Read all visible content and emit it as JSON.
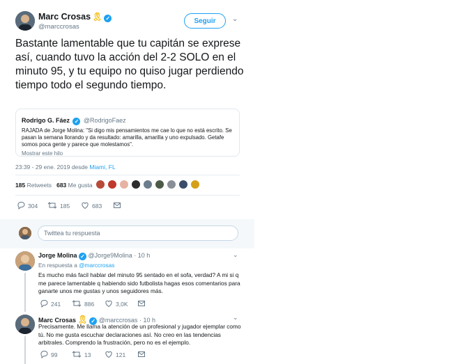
{
  "tweet": {
    "author_name": "Marc Crosas",
    "author_handle": "@marccrosas",
    "follow_label": "Seguir",
    "text": "Bastante lamentable que tu capitán se exprese así, cuando tuvo la acción del 2-2 SOLO en el minuto 95, y tu equipo no quiso jugar perdiendo tiempo todo el segundo tiempo.",
    "quote": {
      "author_name": "Rodrigo G. Fáez",
      "author_handle": "@RodrigoFaez",
      "text": "RAJADA de Jorge Molina: \"Si digo mis pensamientos me cae lo que no está escrito. Se pasan la semana llorando y da resultado: amarilla, amarilla y uno expulsado. Getafe somos poca gente y parece que molestamos\".",
      "thread_link": "Mostrar este hilo"
    },
    "timestamp": "23:39 - 29 ene. 2019 desde",
    "location": "Miami, FL",
    "retweets_count": "185",
    "retweets_label": "Retweets",
    "likes_count": "683",
    "likes_label": "Me gusta",
    "actions": {
      "replies": "304",
      "retweets": "185",
      "likes": "683"
    }
  },
  "compose": {
    "placeholder": "Twittea tu respuesta"
  },
  "replies": [
    {
      "author_name": "Jorge Molina",
      "author_handle": "@Jorge9Molina",
      "time": "· 10 h",
      "in_reply_prefix": "En respuesta a",
      "in_reply_handle": "@marccrosas",
      "text": "Es mucho más facil hablar del minuto 95 sentado en el sofa, verdad? A mi si q me parece lamentable q habiendo sido futbolista hagas esos comentarios para ganarte unos me gustas y unos seguidores más.",
      "actions": {
        "replies": "241",
        "retweets": "886",
        "likes": "3,0K"
      }
    },
    {
      "author_name": "Marc Crosas",
      "author_handle": "@marccrosas",
      "time": "· 10 h",
      "text": "Precisamente. Me llama la atención de un profesional y jugador ejemplar como tú. No me gusta escuchar declaraciones así. No creo en las tendencias arbitrales. Comprendo la frustración, pero no es el ejemplo.",
      "actions": {
        "replies": "99",
        "retweets": "13",
        "likes": "121"
      }
    }
  ],
  "icons": {
    "reply": "reply-icon",
    "retweet": "retweet-icon",
    "like": "heart-icon",
    "message": "direct-message-icon",
    "verified": "verified-badge-icon",
    "ribbon": "yellow-ribbon-icon"
  },
  "colors": {
    "accent": "#1da1f2",
    "secondary_text": "#657786",
    "divider": "#e6ecf0",
    "ribbon": "#f5b800"
  }
}
